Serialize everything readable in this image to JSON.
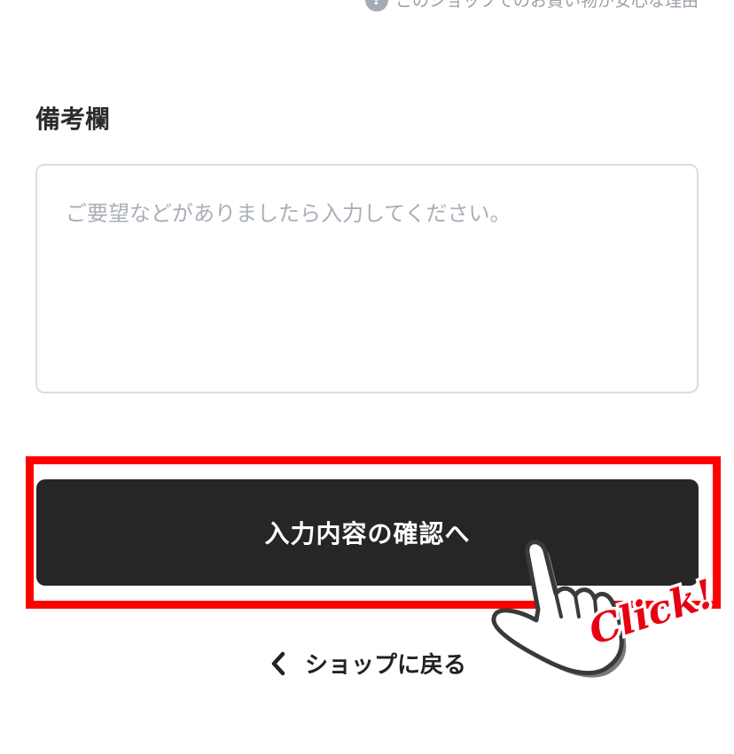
{
  "trust_link": {
    "text": "このショップでのお買い物が安心な理由",
    "icon": "question-circle-icon"
  },
  "notes": {
    "heading": "備考欄",
    "value": "",
    "placeholder": "ご要望などがありましたら入力してください。"
  },
  "confirm_button": {
    "label": "入力内容の確認へ"
  },
  "back_link": {
    "label": "ショップに戻る",
    "icon": "chevron-left-icon"
  },
  "annotation": {
    "click_text": "Click!",
    "highlight_color": "#ff0000"
  },
  "colors": {
    "button_bg": "#262626",
    "placeholder": "#a9afb8",
    "muted_text": "#9aa1ab"
  }
}
